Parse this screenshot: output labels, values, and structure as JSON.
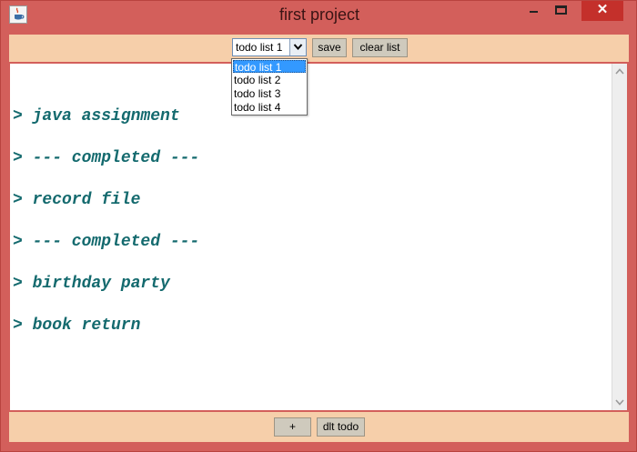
{
  "window": {
    "title": "first project",
    "close_glyph": "✕",
    "icons": [
      "java-cup-icon",
      "minimize-icon",
      "maximize-icon",
      "close-icon"
    ]
  },
  "toolbar": {
    "combo_selected": "todo list 1",
    "save_label": "save",
    "clear_label": "clear list"
  },
  "dropdown": {
    "options": [
      "todo list 1",
      "todo list 2",
      "todo list 3",
      "todo list 4"
    ],
    "selected_index": 0
  },
  "todos": [
    "> java assignment",
    "> --- completed ---",
    "> record file",
    "> --- completed ---",
    "> birthday party",
    "> book return"
  ],
  "bottom": {
    "add_label": "+",
    "delete_label": "dlt todo"
  },
  "colors": {
    "frame": "#d35f5b",
    "panel": "#f6cfaa",
    "todo_text": "#146a6e",
    "selection": "#3399ff",
    "close_button": "#c4302b"
  }
}
